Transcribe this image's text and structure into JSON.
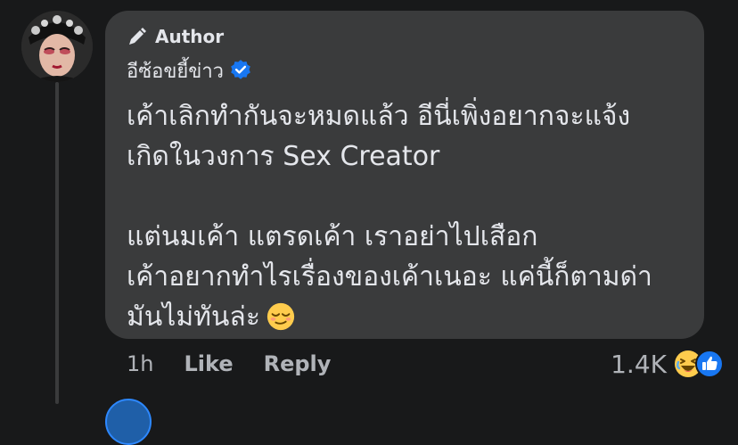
{
  "comment": {
    "badge_icon": "pen-icon",
    "badge_label": "Author",
    "author_name": "อีซ้อขยี้ข่าว",
    "verified_icon": "verified-badge-icon",
    "text_lines": [
      "เค้าเลิกทำกันจะหมดแล้ว อีนี่เพิ่งอยากจะแจ้ง",
      "เกิดในวงการ Sex Creator",
      "",
      "แต่นมเค้า แตรดเค้า เราอย่าไปเสือก",
      "เค้าอยากทำไรเรื่องของเค้าเนอะ แค่นี้ก็ตามด่า",
      "มันไม่ทันล่ะ"
    ],
    "trailing_emoji": "relieved-face-emoji"
  },
  "actions": {
    "time": "1h",
    "like_label": "Like",
    "reply_label": "Reply"
  },
  "reactions": {
    "count": "1.4K",
    "icons": [
      "haha-reaction-icon",
      "like-reaction-icon"
    ]
  },
  "colors": {
    "background": "#18191a",
    "bubble": "#3a3b3c",
    "text": "#e4e6eb",
    "secondary_text": "#b0b3b8",
    "verified_blue": "#1877f2"
  }
}
